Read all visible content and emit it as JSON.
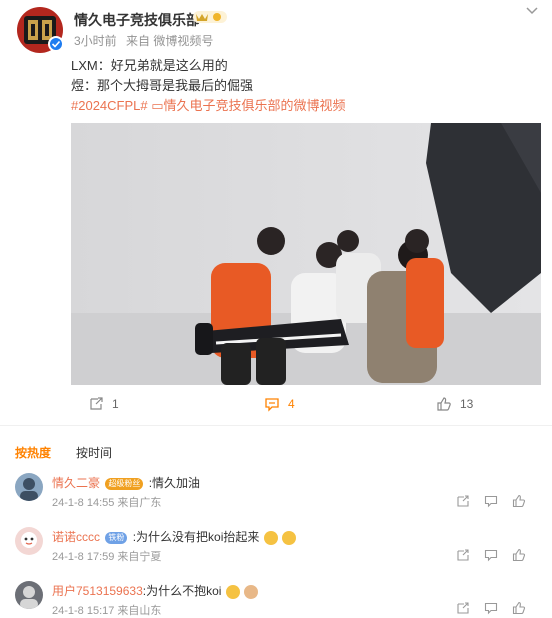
{
  "post": {
    "author": "情久电子竞技俱乐部",
    "time": "3小时前",
    "source": "来自 微博视频号",
    "line1": "LXM：好兄弟就是这么用的",
    "line2": "煜：那个大拇哥是我最后的倔强",
    "topic": "#2024CFPL#",
    "video_link": "情久电子竞技俱乐部的微博视频",
    "reposts": "1",
    "comments": "4",
    "likes": "13"
  },
  "tabs": [
    "按热度",
    "按时间"
  ],
  "comments": [
    {
      "user": "情久二豪",
      "badge": "超级粉丝",
      "text": ":情久加油",
      "meta": "24-1-8 14:55 来自广东"
    },
    {
      "user": "诺诺cccc",
      "badge": "铁粉",
      "text": ":为什么没有把koi抬起来",
      "meta": "24-1-8 17:59 来自宁夏"
    },
    {
      "user": "用户7513159633",
      "text": ":为什么不抱koi",
      "meta": "24-1-8 15:17 来自山东"
    }
  ],
  "colors": {
    "accent": "#ff8200",
    "link": "#eb7350",
    "brand_red": "#b3271e"
  }
}
